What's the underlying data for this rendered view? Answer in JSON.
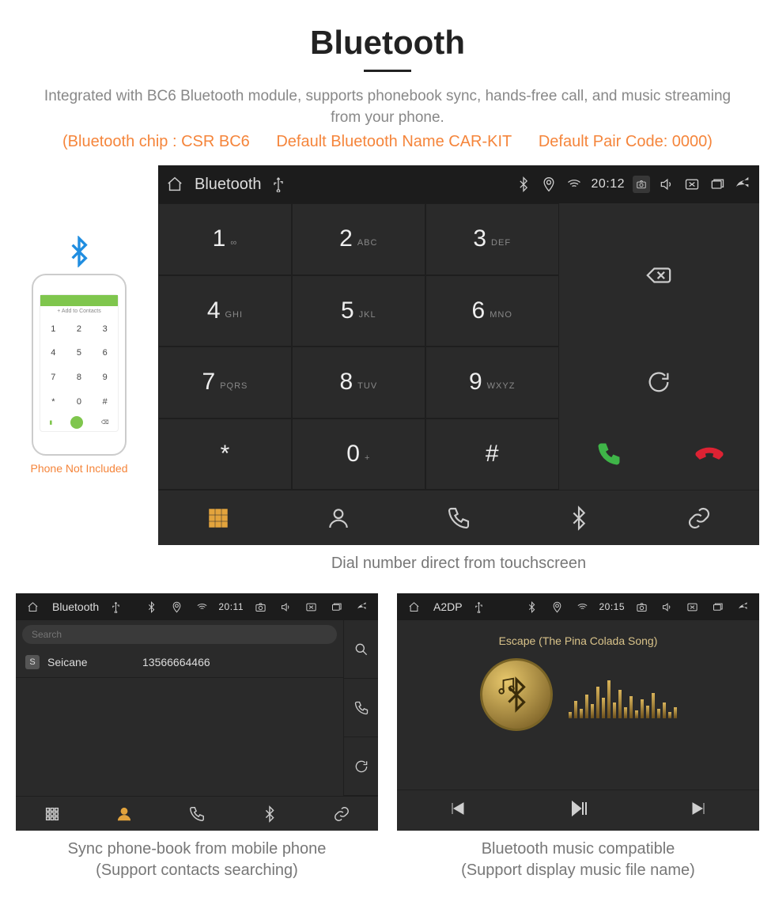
{
  "title": "Bluetooth",
  "description": "Integrated with BC6 Bluetooth module, supports phonebook sync, hands-free call, and music streaming from your phone.",
  "spec": {
    "chip": "(Bluetooth chip : CSR BC6",
    "name": "Default Bluetooth Name CAR-KIT",
    "code": "Default Pair Code: 0000)"
  },
  "phone": {
    "add_contact": "+ Add to Contacts",
    "keys": [
      "1",
      "2",
      "3",
      "4",
      "5",
      "6",
      "7",
      "8",
      "9",
      "*",
      "0",
      "#"
    ],
    "caption": "Phone Not Included"
  },
  "dialer": {
    "status": {
      "title": "Bluetooth",
      "time": "20:12"
    },
    "keys": [
      {
        "n": "1",
        "s": "∞"
      },
      {
        "n": "2",
        "s": "ABC"
      },
      {
        "n": "3",
        "s": "DEF"
      },
      {
        "n": "4",
        "s": "GHI"
      },
      {
        "n": "5",
        "s": "JKL"
      },
      {
        "n": "6",
        "s": "MNO"
      },
      {
        "n": "7",
        "s": "PQRS"
      },
      {
        "n": "8",
        "s": "TUV"
      },
      {
        "n": "9",
        "s": "WXYZ"
      },
      {
        "n": "*",
        "s": ""
      },
      {
        "n": "0",
        "s": "+"
      },
      {
        "n": "#",
        "s": ""
      }
    ],
    "caption": "Dial number direct from touchscreen"
  },
  "phonebook": {
    "status": {
      "title": "Bluetooth",
      "time": "20:11"
    },
    "search_placeholder": "Search",
    "contact": {
      "initial": "S",
      "name": "Seicane",
      "number": "13566664466"
    },
    "caption_l1": "Sync phone-book from mobile phone",
    "caption_l2": "(Support contacts searching)"
  },
  "music": {
    "status": {
      "title": "A2DP",
      "time": "20:15"
    },
    "track": "Escape (The Pina Colada Song)",
    "caption_l1": "Bluetooth music compatible",
    "caption_l2": "(Support display music file name)"
  },
  "eq_heights": [
    8,
    22,
    12,
    30,
    18,
    40,
    26,
    48,
    20,
    36,
    14,
    28,
    10,
    24,
    16,
    32,
    12,
    20,
    8,
    14
  ]
}
